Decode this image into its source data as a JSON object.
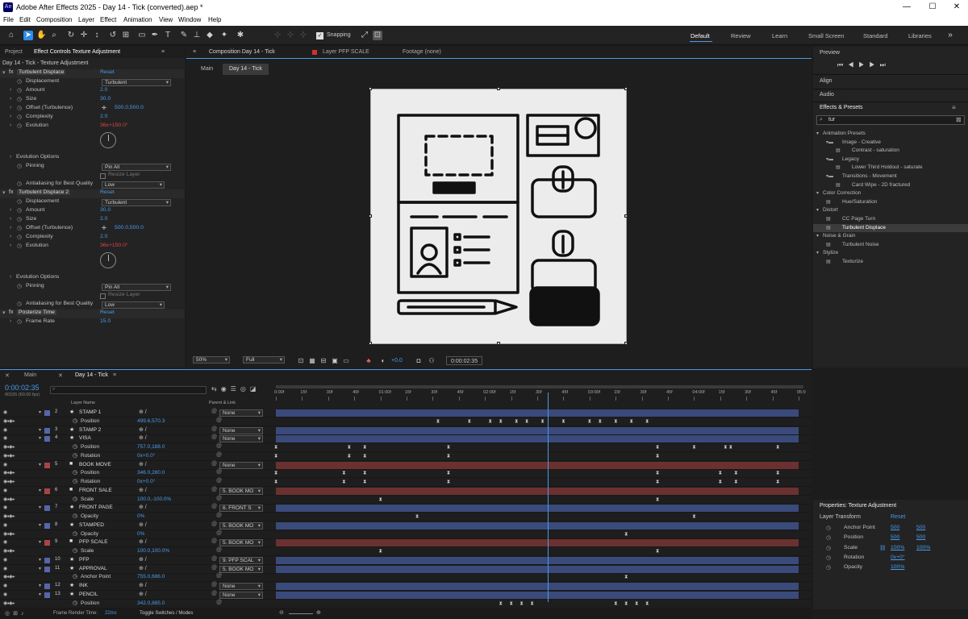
{
  "app": {
    "title": "Adobe After Effects 2025 - Day 14 - Tick (converted).aep *",
    "icon": "Ae"
  },
  "menu": [
    "File",
    "Edit",
    "Composition",
    "Layer",
    "Effect",
    "Animation",
    "View",
    "Window",
    "Help"
  ],
  "toolbar": {
    "snapping": "Snapping"
  },
  "workspaces": [
    "Default",
    "Review",
    "Learn",
    "Small Screen",
    "Standard",
    "Libraries"
  ],
  "left_tabs": {
    "project": "Project",
    "effect_controls": "Effect Controls Texture Adjustment"
  },
  "effect_controls": {
    "header": "Day 14 - Tick - Texture Adjustment",
    "effects": [
      {
        "name": "Turbulent Displace",
        "reset": "Reset",
        "props": [
          {
            "label": "Displacement",
            "dropdown": "Turbulent"
          },
          {
            "label": "Amount",
            "value": "2.0"
          },
          {
            "label": "Size",
            "value": "30.0"
          },
          {
            "label": "Offset (Turbulence)",
            "value": "500.0,500.0"
          },
          {
            "label": "Complexity",
            "value": "2.0"
          },
          {
            "label": "Evolution",
            "value": "36x+150.0°"
          }
        ],
        "options": "Evolution Options",
        "pinning_label": "Pinning",
        "pinning": "Pin All",
        "resize": "Resize Layer",
        "aa_label": "Antialiasing for Best Quality",
        "aa": "Low"
      },
      {
        "name": "Turbulent Displace 2",
        "reset": "Reset",
        "props": [
          {
            "label": "Displacement",
            "dropdown": "Turbulent"
          },
          {
            "label": "Amount",
            "value": "30.0"
          },
          {
            "label": "Size",
            "value": "2.0"
          },
          {
            "label": "Offset (Turbulence)",
            "value": "500.0,500.0"
          },
          {
            "label": "Complexity",
            "value": "2.0"
          },
          {
            "label": "Evolution",
            "value": "36x+150.0°"
          }
        ],
        "options": "Evolution Options",
        "pinning_label": "Pinning",
        "pinning": "Pin All",
        "resize": "Resize Layer",
        "aa_label": "Antialiasing for Best Quality",
        "aa": "Low"
      },
      {
        "name": "Posterize Time",
        "reset": "Reset",
        "props": [
          {
            "label": "Frame Rate",
            "value": "15.0"
          }
        ]
      }
    ]
  },
  "comp": {
    "tab": "Composition Day 14 - Tick",
    "layer_tab": "Layer PFP SCALE",
    "footage_tab": "Footage (none)",
    "crumb_main": "Main",
    "crumb_active": "Day 14 - Tick",
    "zoom": "50%",
    "quality": "Full",
    "exposure": "+0.0",
    "time": "0:00:02:35"
  },
  "right": {
    "preview": "Preview",
    "align": "Align",
    "audio": "Audio",
    "effects_presets": "Effects & Presets",
    "search": "tur",
    "tree": [
      {
        "t": "Animation Presets",
        "lvl": 0,
        "kind": "open"
      },
      {
        "t": "Image - Creative",
        "lvl": 1,
        "kind": "folder"
      },
      {
        "t": "Contrast - saturation",
        "lvl": 2,
        "kind": "fx"
      },
      {
        "t": "Legacy",
        "lvl": 1,
        "kind": "folder"
      },
      {
        "t": "Lower Third Holdout - saturate",
        "lvl": 2,
        "kind": "fx"
      },
      {
        "t": "Transitions - Movement",
        "lvl": 1,
        "kind": "folder"
      },
      {
        "t": "Card Wipe - 2D fractured",
        "lvl": 2,
        "kind": "fx"
      },
      {
        "t": "Color Correction",
        "lvl": 0,
        "kind": "open"
      },
      {
        "t": "Hue/Saturation",
        "lvl": 1,
        "kind": "fx"
      },
      {
        "t": "Distort",
        "lvl": 0,
        "kind": "open"
      },
      {
        "t": "CC Page Turn",
        "lvl": 1,
        "kind": "fx"
      },
      {
        "t": "Turbulent Displace",
        "lvl": 1,
        "kind": "fx",
        "sel": true
      },
      {
        "t": "Noise & Grain",
        "lvl": 0,
        "kind": "open"
      },
      {
        "t": "Turbulent Noise",
        "lvl": 1,
        "kind": "fx"
      },
      {
        "t": "Stylize",
        "lvl": 0,
        "kind": "open"
      },
      {
        "t": "Texturize",
        "lvl": 1,
        "kind": "fx"
      }
    ],
    "properties": {
      "title": "Properties: Texture Adjustment",
      "group": "Layer Transform",
      "reset": "Reset",
      "rows": [
        {
          "label": "Anchor Point",
          "v1": "500",
          "v2": "500"
        },
        {
          "label": "Position",
          "v1": "500",
          "v2": "500"
        },
        {
          "label": "Scale",
          "v1": "100%",
          "v2": "100%"
        },
        {
          "label": "Rotation",
          "v1": "0x+0°",
          "v2": ""
        },
        {
          "label": "Opacity",
          "v1": "100%",
          "v2": ""
        }
      ]
    }
  },
  "timeline": {
    "tab_main": "Main",
    "tab_active": "Day 14 - Tick",
    "timecode": "0:00:02:35",
    "frames": "00155 (60.00 fps)",
    "col_layer": "Layer Name",
    "col_parent": "Parent & Link",
    "ruler": [
      "0:00f",
      "15f",
      "30f",
      "45f",
      "01:00f",
      "15f",
      "30f",
      "45f",
      "02:00f",
      "15f",
      "30f",
      "45f",
      "03:00f",
      "15f",
      "30f",
      "45f",
      "04:00f",
      "15f",
      "30f",
      "45f",
      "05:0"
    ],
    "rows": [
      {
        "type": "layer",
        "num": "2",
        "name": "STAMP 1",
        "parent": "None",
        "color": "#5566aa",
        "star": true
      },
      {
        "type": "prop",
        "name": "Position",
        "value": "499.6,570.3",
        "keys": [
          0.31,
          0.37,
          0.41,
          0.43,
          0.46,
          0.48,
          0.51,
          0.55,
          0.6,
          0.62,
          0.65,
          0.68,
          0.71
        ]
      },
      {
        "type": "layer",
        "num": "3",
        "name": "STAMP 2",
        "parent": "None",
        "color": "#5566aa",
        "star": true
      },
      {
        "type": "layer",
        "num": "4",
        "name": "VISA",
        "parent": "None",
        "color": "#5566aa",
        "star": true
      },
      {
        "type": "prop",
        "name": "Position",
        "value": "757.0,188.0",
        "keys": [
          0.0,
          0.14,
          0.17,
          0.33,
          0.73,
          0.8,
          0.86,
          0.87,
          0.96
        ]
      },
      {
        "type": "prop",
        "name": "Rotation",
        "value": "0x+0.0°",
        "keys": [
          0.0,
          0.14,
          0.17,
          0.33,
          0.73
        ]
      },
      {
        "type": "layer",
        "num": "5",
        "name": "BOOK MOVE",
        "parent": "None",
        "color": "#aa4444",
        "star": false
      },
      {
        "type": "prop",
        "name": "Position",
        "value": "346.0,280.0",
        "keys": [
          0.0,
          0.13,
          0.17,
          0.33,
          0.73,
          0.85,
          0.88,
          0.96
        ]
      },
      {
        "type": "prop",
        "name": "Rotation",
        "value": "0x+0.0°",
        "keys": [
          0.0,
          0.13,
          0.17,
          0.33,
          0.73,
          0.85,
          0.88,
          0.96
        ]
      },
      {
        "type": "layer",
        "num": "6",
        "name": "FRONT SALE",
        "parent": "5. BOOK MO",
        "color": "#aa4444",
        "star": false
      },
      {
        "type": "prop",
        "name": "Scale",
        "value": "100.0,-100.0%",
        "keys": [
          0.2,
          0.73
        ]
      },
      {
        "type": "layer",
        "num": "7",
        "name": "FRONT PAGE",
        "parent": "6. FRONT S",
        "color": "#5566aa",
        "star": true
      },
      {
        "type": "prop",
        "name": "Opacity",
        "value": "0%",
        "keys": [
          0.27,
          0.8
        ]
      },
      {
        "type": "layer",
        "num": "8",
        "name": "STAMPED",
        "parent": "5. BOOK MO",
        "color": "#5566aa",
        "star": true
      },
      {
        "type": "prop",
        "name": "Opacity",
        "value": "0%",
        "keys": [
          0.67
        ]
      },
      {
        "type": "layer",
        "num": "9",
        "name": "PFP SCALE",
        "parent": "5. BOOK MO",
        "color": "#aa4444",
        "star": false
      },
      {
        "type": "prop",
        "name": "Scale",
        "value": "100.0,100.0%",
        "keys": [
          0.2,
          0.73
        ]
      },
      {
        "type": "layer",
        "num": "10",
        "name": "PFP",
        "parent": "9. PFP SCAL",
        "color": "#5566aa",
        "star": true
      },
      {
        "type": "layer",
        "num": "11",
        "name": "APPROVAL",
        "parent": "5. BOOK MO",
        "color": "#5566aa",
        "star": true
      },
      {
        "type": "prop",
        "name": "Anchor Point",
        "value": "755.0,686.0",
        "keys": [
          0.67
        ]
      },
      {
        "type": "layer",
        "num": "12",
        "name": "INK",
        "parent": "None",
        "color": "#5566aa",
        "star": true
      },
      {
        "type": "layer",
        "num": "13",
        "name": "PENCIL",
        "parent": "None",
        "color": "#5566aa",
        "star": true
      },
      {
        "type": "prop",
        "name": "Position",
        "value": "342.0,885.0",
        "keys": [
          0.43,
          0.45,
          0.47,
          0.49,
          0.65,
          0.67,
          0.69,
          0.71
        ]
      }
    ],
    "playhead": 0.52,
    "render_time_label": "Frame Render Time:",
    "render_time": "22ms",
    "toggle": "Toggle Switches / Modes"
  }
}
